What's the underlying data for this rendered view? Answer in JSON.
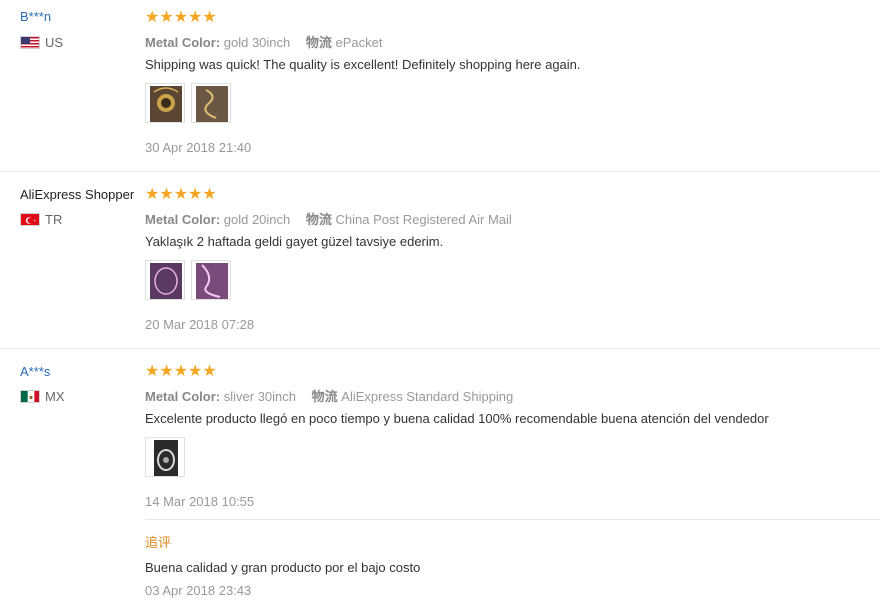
{
  "reviews": [
    {
      "user": "B***n",
      "country": "US",
      "flag_icon": "us-flag-icon",
      "stars": "★★★★★",
      "color_label": "Metal Color:",
      "color_value": "gold 30inch",
      "shipping_label": "物流",
      "shipping_value": "ePacket",
      "text": "Shipping was quick! The quality is excellent! Definitely shopping here again.",
      "photo_count": 2,
      "date": "30 Apr 2018 21:40"
    },
    {
      "user": "AliExpress Shopper",
      "country": "TR",
      "flag_icon": "tr-flag-icon",
      "stars": "★★★★★",
      "color_label": "Metal Color:",
      "color_value": "gold 20inch",
      "shipping_label": "物流",
      "shipping_value": "China Post Registered Air Mail",
      "text": "Yaklaşık 2 haftada geldi gayet güzel tavsiye ederim.",
      "photo_count": 2,
      "date": "20 Mar 2018 07:28"
    },
    {
      "user": "A***s",
      "country": "MX",
      "flag_icon": "mx-flag-icon",
      "stars": "★★★★★",
      "color_label": "Metal Color:",
      "color_value": "sliver 30inch",
      "shipping_label": "物流",
      "shipping_value": "AliExpress Standard Shipping",
      "text": "Excelente producto llegó en poco tiempo y buena calidad 100% recomendable buena atención del vendedor",
      "photo_count": 1,
      "date": "14 Mar 2018 10:55",
      "followup": {
        "label": "追评",
        "text": "Buena calidad y gran producto por el bajo costo",
        "date": "03 Apr 2018 23:43"
      }
    }
  ],
  "rating": 5,
  "colors": {
    "star": "#f5a623",
    "username": "#2a6bb5",
    "followup_label": "#e08a1e"
  }
}
